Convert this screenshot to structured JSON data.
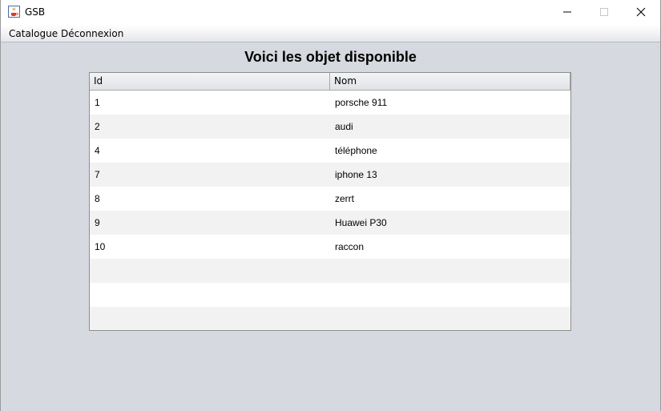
{
  "window": {
    "title": "GSB",
    "icon": "java-cup-icon",
    "controls": [
      "minimize-icon",
      "maximize-icon",
      "close-icon"
    ]
  },
  "menubar": {
    "items": [
      {
        "label": "Catalogue"
      },
      {
        "label": "Déconnexion"
      }
    ]
  },
  "main": {
    "heading": "Voici les objet disponible",
    "table": {
      "columns": [
        "Id",
        "Nom"
      ],
      "rows": [
        [
          "1",
          "porsche 911"
        ],
        [
          "2",
          "audi"
        ],
        [
          "4",
          "téléphone"
        ],
        [
          "7",
          "iphone 13"
        ],
        [
          "8",
          "zerrt"
        ],
        [
          "9",
          "Huawei P30"
        ],
        [
          "10",
          "raccon"
        ],
        [
          "",
          ""
        ],
        [
          "",
          ""
        ],
        [
          "",
          ""
        ]
      ]
    }
  },
  "colors": {
    "background": "#d6d9df",
    "row_alt": "#f2f2f2",
    "row": "#ffffff"
  }
}
